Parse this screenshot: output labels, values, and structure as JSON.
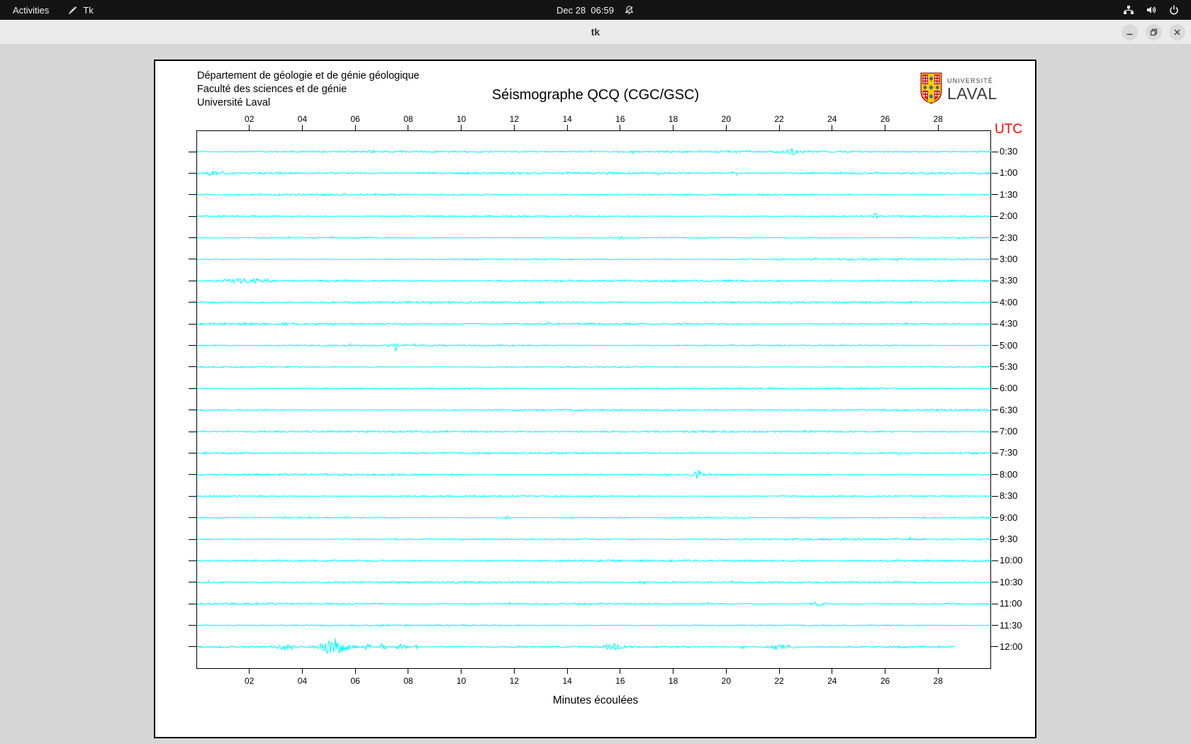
{
  "top_bar": {
    "activities_label": "Activities",
    "app_name": "Tk",
    "clock": "Dec 28  06:59",
    "icons": [
      "tk-icon",
      "notifications-muted-icon",
      "network-icon",
      "volume-icon",
      "power-icon"
    ]
  },
  "window": {
    "title": "tk",
    "buttons": [
      "minimize",
      "restore",
      "close"
    ]
  },
  "page": {
    "org_lines": {
      "0": "Département de géologie et de génie géologique",
      "1": "Faculté des sciences et de génie",
      "2": "Université Laval"
    },
    "title": "Séismographe QCQ (CGC/GSC)",
    "utc_label": "UTC",
    "xlabel": "Minutes écoulées",
    "logo": {
      "line1": "UNIVERSITÉ",
      "line2": "LAVAL"
    }
  },
  "colors": {
    "trace": "#00ffff",
    "utc_label": "#ff0000",
    "canvas_bg": "#ffffff",
    "desktop_bg": "#d7d7d7",
    "topbar_bg": "#141414",
    "logo_red": "#c8102e",
    "logo_gold": "#ffcc00",
    "logo_blue": "#1f6fb2"
  },
  "chart_data": {
    "type": "line",
    "title": "Séismographe QCQ (CGC/GSC)",
    "xlabel": "Minutes écoulées",
    "xlim": [
      0,
      30
    ],
    "x_tick_labels": [
      "02",
      "04",
      "06",
      "08",
      "10",
      "12",
      "14",
      "16",
      "18",
      "20",
      "22",
      "24",
      "26",
      "28"
    ],
    "x_tick_minutes": [
      2,
      4,
      6,
      8,
      10,
      12,
      14,
      16,
      18,
      20,
      22,
      24,
      26,
      28
    ],
    "right_axis_label": "UTC",
    "trace_color": "#00ffff",
    "rows": [
      {
        "label": "0:30",
        "end": 30,
        "noise": 1.2,
        "events": [
          {
            "m": 6.6,
            "a": 2.5,
            "w": 0.15
          },
          {
            "m": 22.5,
            "a": 5.0,
            "w": 0.25
          }
        ]
      },
      {
        "label": "1:00",
        "end": 30,
        "noise": 1.25,
        "events": [
          {
            "m": 0.6,
            "a": 3.0,
            "w": 0.6
          },
          {
            "m": 20.3,
            "a": 4.5,
            "w": 0.12
          }
        ]
      },
      {
        "label": "1:30",
        "end": 30,
        "noise": 1.15,
        "events": []
      },
      {
        "label": "2:00",
        "end": 30,
        "noise": 1.2,
        "events": [
          {
            "m": 25.6,
            "a": 5.0,
            "w": 0.12
          }
        ]
      },
      {
        "label": "2:30",
        "end": 30,
        "noise": 1.15,
        "events": [
          {
            "m": 16.0,
            "a": 3.0,
            "w": 0.12
          }
        ]
      },
      {
        "label": "3:00",
        "end": 30,
        "noise": 1.1,
        "events": []
      },
      {
        "label": "3:30",
        "end": 30,
        "noise": 1.2,
        "events": [
          {
            "m": 1.9,
            "a": 3.8,
            "w": 0.9
          }
        ]
      },
      {
        "label": "4:00",
        "end": 30,
        "noise": 1.15,
        "events": []
      },
      {
        "label": "4:30",
        "end": 30,
        "noise": 1.2,
        "events": []
      },
      {
        "label": "5:00",
        "end": 30,
        "noise": 1.15,
        "events": [
          {
            "m": 7.5,
            "a": 9.0,
            "w": 0.07
          }
        ]
      },
      {
        "label": "5:30",
        "end": 30,
        "noise": 1.1,
        "events": []
      },
      {
        "label": "6:00",
        "end": 30,
        "noise": 1.15,
        "events": []
      },
      {
        "label": "6:30",
        "end": 30,
        "noise": 1.1,
        "events": []
      },
      {
        "label": "7:00",
        "end": 30,
        "noise": 1.15,
        "events": []
      },
      {
        "label": "7:30",
        "end": 30,
        "noise": 1.1,
        "events": []
      },
      {
        "label": "8:00",
        "end": 30,
        "noise": 1.2,
        "events": [
          {
            "m": 18.9,
            "a": 8.0,
            "w": 0.2
          }
        ]
      },
      {
        "label": "8:30",
        "end": 30,
        "noise": 1.2,
        "events": []
      },
      {
        "label": "9:00",
        "end": 30,
        "noise": 1.15,
        "events": [
          {
            "m": 11.7,
            "a": 2.5,
            "w": 0.15
          }
        ]
      },
      {
        "label": "9:30",
        "end": 30,
        "noise": 1.1,
        "events": []
      },
      {
        "label": "10:00",
        "end": 30,
        "noise": 1.15,
        "events": []
      },
      {
        "label": "10:30",
        "end": 30,
        "noise": 1.1,
        "events": [
          {
            "m": 16.8,
            "a": 2.2,
            "w": 0.2
          }
        ]
      },
      {
        "label": "11:00",
        "end": 30,
        "noise": 1.15,
        "events": [
          {
            "m": 23.5,
            "a": 3.0,
            "w": 0.3
          }
        ]
      },
      {
        "label": "11:30",
        "end": 30,
        "noise": 1.2,
        "events": []
      },
      {
        "label": "12:00",
        "end": 28.6,
        "noise": 1.6,
        "events": [
          {
            "m": 3.3,
            "a": 4.0,
            "w": 0.5
          },
          {
            "m": 5.2,
            "a": 13.0,
            "w": 0.55
          },
          {
            "m": 6.4,
            "a": 6.0,
            "w": 0.15
          },
          {
            "m": 7.0,
            "a": 7.0,
            "w": 0.12
          },
          {
            "m": 7.7,
            "a": 5.0,
            "w": 0.3
          },
          {
            "m": 8.3,
            "a": 5.0,
            "w": 0.08
          },
          {
            "m": 15.7,
            "a": 5.0,
            "w": 0.35
          },
          {
            "m": 20.6,
            "a": 3.0,
            "w": 0.15
          },
          {
            "m": 22.0,
            "a": 3.5,
            "w": 0.5
          }
        ]
      }
    ]
  }
}
